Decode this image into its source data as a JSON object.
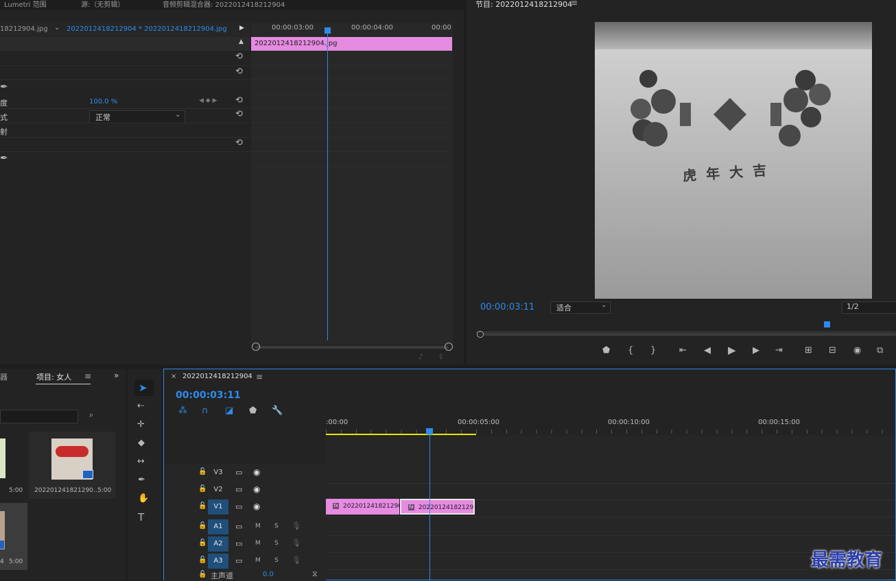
{
  "top_tabs": {
    "lumetri": "Lumetri 范围",
    "source": "源:（无剪辑）",
    "audio_mixer": "音频剪辑混合器: 2022012418212904",
    "program": "节目: 2022012418212904"
  },
  "effect_controls": {
    "clip_tab_left": "18212904.jpg",
    "clip_tab_active": "2022012418212904 * 2022012418212904.jpg",
    "opacity_label": "度",
    "opacity_value": "100.0 %",
    "blend_label": "式",
    "blend_value": "正常",
    "mapping_label": "射",
    "timecodes": [
      "00:00:03:00",
      "00:00:04:00",
      "00:00"
    ],
    "clip_bar_label": "2022012418212904.jpg"
  },
  "program_monitor": {
    "timecode": "00:00:03:11",
    "fit_label": "适合",
    "resolution": "1/2",
    "image_text": "虎年大吉"
  },
  "project_panel": {
    "left_tab": "器",
    "active_tab": "项目: 女人",
    "items": [
      {
        "name": "",
        "duration": "5:00"
      },
      {
        "name": "202201241821290...",
        "duration": "5:00"
      },
      {
        "name": "4",
        "duration": "5:00"
      }
    ]
  },
  "timeline": {
    "sequence_name": "2022012418212904",
    "timecode": "00:00:03:11",
    "ruler": [
      ":00:00",
      "00:00:05:00",
      "00:00:10:00",
      "00:00:15:00"
    ],
    "video_tracks": [
      "V3",
      "V2",
      "V1"
    ],
    "audio_tracks": [
      "A1",
      "A2",
      "A3"
    ],
    "audio_buttons": {
      "mute": "M",
      "solo": "S"
    },
    "master_label": "主声道",
    "master_value": "0.0",
    "clips": [
      {
        "label": "202201241821290"
      },
      {
        "label": "20220124182129"
      }
    ]
  },
  "watermark": "最需教育",
  "colors": {
    "accent_blue": "#2d8ceb",
    "clip_pink": "#e58be0",
    "work_area_yellow": "#e6e600",
    "panel_bg": "#232323"
  }
}
